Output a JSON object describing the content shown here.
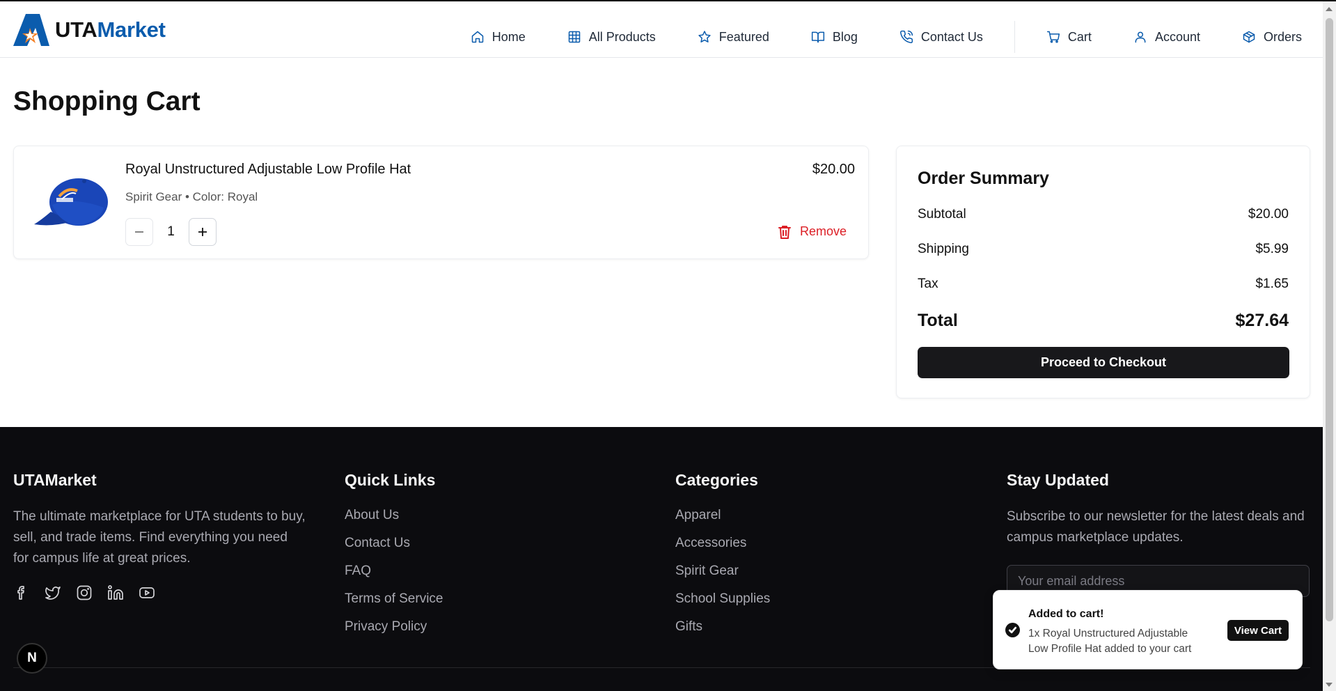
{
  "header": {
    "logo": {
      "part1": "UTA",
      "part2": "Market",
      "icon": "uta-star-logo-icon"
    },
    "nav": [
      {
        "label": "Home",
        "icon": "home-icon"
      },
      {
        "label": "All Products",
        "icon": "grid-icon"
      },
      {
        "label": "Featured",
        "icon": "star-icon"
      },
      {
        "label": "Blog",
        "icon": "book-open-icon"
      },
      {
        "label": "Contact Us",
        "icon": "phone-icon"
      }
    ],
    "user_nav": [
      {
        "label": "Cart",
        "icon": "cart-icon"
      },
      {
        "label": "Account",
        "icon": "user-icon"
      },
      {
        "label": "Orders",
        "icon": "package-icon"
      }
    ],
    "accent_color": "#0b5cad"
  },
  "page": {
    "title": "Shopping Cart"
  },
  "cart": {
    "items": [
      {
        "name": "Royal Unstructured Adjustable Low Profile Hat",
        "meta": "Spirit Gear • Color: Royal",
        "price": "$20.00",
        "quantity": "1",
        "remove_label": "Remove",
        "image_icon": "royal-hat-image"
      }
    ]
  },
  "summary": {
    "title": "Order Summary",
    "subtotal_label": "Subtotal",
    "subtotal": "$20.00",
    "shipping_label": "Shipping",
    "shipping": "$5.99",
    "tax_label": "Tax",
    "tax": "$1.65",
    "total_label": "Total",
    "total": "$27.64",
    "checkout_label": "Proceed to Checkout"
  },
  "footer": {
    "brand": {
      "title": "UTAMarket",
      "text": "The ultimate marketplace for UTA students to buy, sell, and trade items. Find everything you need for campus life at great prices.",
      "socials": [
        "facebook-icon",
        "twitter-icon",
        "instagram-icon",
        "linkedin-icon",
        "youtube-icon"
      ]
    },
    "quick_links": {
      "title": "Quick Links",
      "items": [
        "About Us",
        "Contact Us",
        "FAQ",
        "Terms of Service",
        "Privacy Policy"
      ]
    },
    "categories": {
      "title": "Categories",
      "items": [
        "Apparel",
        "Accessories",
        "Spirit Gear",
        "School Supplies",
        "Gifts"
      ]
    },
    "newsletter": {
      "title": "Stay Updated",
      "text": "Subscribe to our newsletter for the latest deals and campus marketplace updates.",
      "placeholder": "Your email address"
    }
  },
  "toast": {
    "title": "Added to cart!",
    "message": "1x Royal Unstructured Adjustable Low Profile Hat added to your cart",
    "action": "View Cart"
  },
  "dev_badge": "N"
}
